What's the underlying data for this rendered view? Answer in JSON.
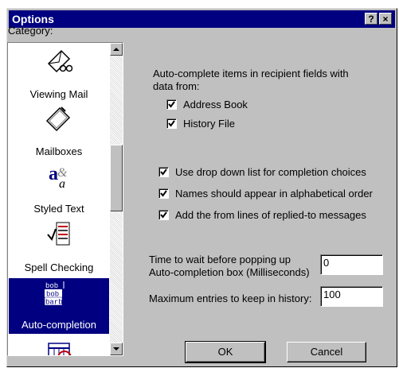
{
  "window": {
    "title": "Options",
    "help_glyph": "?",
    "close_glyph": "×"
  },
  "category": {
    "label": "Category:",
    "items": [
      {
        "label": "Viewing Mail",
        "icon": "viewing-mail-icon"
      },
      {
        "label": "Mailboxes",
        "icon": "mailboxes-icon"
      },
      {
        "label": "Styled Text",
        "icon": "styled-text-icon"
      },
      {
        "label": "Spell Checking",
        "icon": "spell-checking-icon"
      },
      {
        "label": "Auto-completion",
        "icon": "auto-completion-icon",
        "selected": true
      }
    ]
  },
  "autocomplete": {
    "intro_line1": "Auto-complete items in recipient fields with",
    "intro_line2": "data from:",
    "address_book": {
      "label": "Address Book",
      "checked": true
    },
    "history_file": {
      "label": "History File",
      "checked": true
    },
    "drop_down": {
      "label": "Use drop down list for completion choices",
      "checked": true
    },
    "alphabetical": {
      "label": "Names should appear in alphabetical order",
      "checked": true
    },
    "from_lines": {
      "label": "Add the from lines of replied-to messages",
      "checked": true
    },
    "wait_label_line1": "Time to wait before popping up",
    "wait_label_line2": "Auto-completion box (Milliseconds)",
    "wait_value": "0",
    "max_label": "Maximum entries to keep in history:",
    "max_value": "100"
  },
  "buttons": {
    "ok": "OK",
    "cancel": "Cancel"
  }
}
